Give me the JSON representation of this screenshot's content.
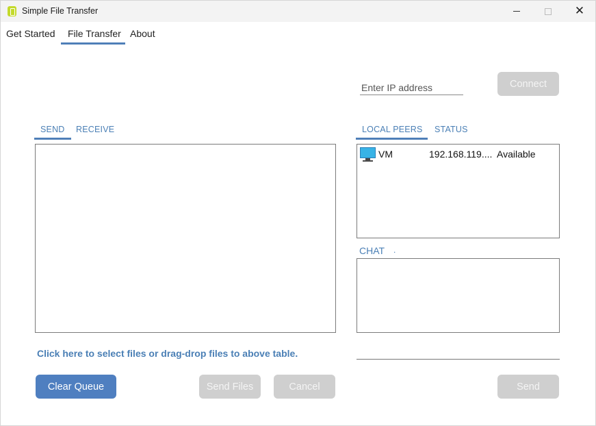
{
  "window": {
    "title": "Simple File Transfer",
    "close_glyph": "✕"
  },
  "nav": {
    "tabs": [
      {
        "label": "Get Started"
      },
      {
        "label": "File Transfer",
        "active": true
      },
      {
        "label": "About"
      }
    ]
  },
  "connection": {
    "ip_placeholder": "Enter IP address",
    "ip_value": "",
    "connect_label": "Connect"
  },
  "transfer": {
    "tabs": [
      {
        "label": "SEND",
        "active": true
      },
      {
        "label": "RECEIVE"
      }
    ],
    "hint": "Click here to select files or drag-drop files to above table.",
    "clear_queue_label": "Clear Queue",
    "send_files_label": "Send Files",
    "cancel_label": "Cancel"
  },
  "peers": {
    "tabs": [
      {
        "label": "LOCAL PEERS",
        "active": true
      },
      {
        "label": "STATUS"
      }
    ],
    "rows": [
      {
        "icon": "computer-icon",
        "name": "VM",
        "ip": "192.168.119....",
        "status": "Available"
      }
    ]
  },
  "chat": {
    "label": "CHAT",
    "dot": ".",
    "input_value": "",
    "send_label": "Send"
  },
  "colors": {
    "accent": "#4f7fb8",
    "primary_button": "#4f7fc0",
    "disabled_button": "#cfcfcf",
    "app_icon": "#c3d92a",
    "computer_screen": "#38b3e6"
  }
}
